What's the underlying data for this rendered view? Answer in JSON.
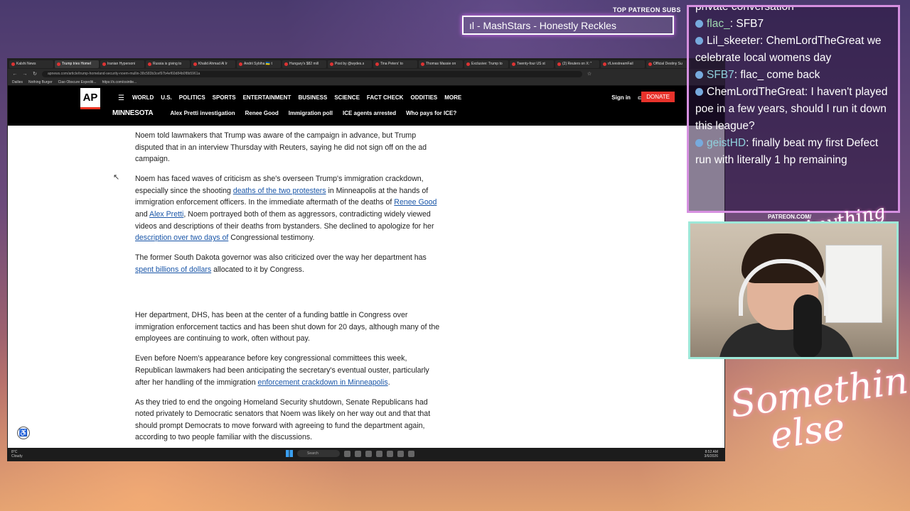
{
  "overlay": {
    "patreon_label": "TOP PATREON SUBS",
    "marquee_text": "ıl - MashStars - Honestly Reckles",
    "patreon_com": "PATREON.COM/",
    "signature_small": "Anything else",
    "signature_large": "Something else"
  },
  "chat": [
    {
      "user": "",
      "text": "private conversation",
      "user_color": "white"
    },
    {
      "user": "flac_",
      "text": ": SFB7",
      "user_color": "green"
    },
    {
      "user": "Lil_skeeter",
      "text": ": ChemLordTheGreat we celebrate local womens day",
      "user_color": "white"
    },
    {
      "user": "SFB7",
      "text": ": flac_  come back",
      "user_color": "teal"
    },
    {
      "user": "ChemLordTheGreat",
      "text": ": I haven't played poe in a few years, should I run it down this league?",
      "user_color": "white"
    },
    {
      "user": "geistHD",
      "text": ": finally beat my first Defect run with literally 1 hp remaining",
      "user_color": "teal"
    }
  ],
  "browser": {
    "tabs": [
      "Kalshi News",
      "Trump tries Homel",
      "Iranian Hypersoni",
      "Russia is giving to",
      "Khalid Ahmad Al Ir",
      "Andrii Sybiha 🇺🇦 t",
      "Hungary's $82 mill",
      "Post by @wydes.s",
      "Tina Peters' to",
      "Thomas Massie on",
      "Exclusive: Trump to",
      "Twenty-four US st",
      "(2) Reuters on X: \"",
      "r/LivestreamFail",
      "Official Destiny Su"
    ],
    "url": "apnews.com/article/trump-homeland-security-noem-mullin-38c583b3cef97b4ef60d84b0f8b5961a",
    "bookmarks": [
      "Dailies",
      "Nothing Burger",
      "Ciao Obscure Expediti...",
      "https://x.com/osintte..."
    ]
  },
  "ap": {
    "logo": "AP",
    "nav": [
      "WORLD",
      "U.S.",
      "POLITICS",
      "SPORTS",
      "ENTERTAINMENT",
      "BUSINESS",
      "SCIENCE",
      "FACT CHECK",
      "ODDITIES",
      "MORE"
    ],
    "sign_in": "Sign in",
    "donate": "DONATE",
    "state": "MINNESOTA",
    "subnav": [
      "Alex Pretti investigation",
      "Renee Good",
      "Immigration poll",
      "ICE agents arrested",
      "Who pays for ICE?"
    ]
  },
  "article": {
    "p1": "Noem told lawmakers that Trump was aware of the campaign in advance, but Trump disputed that in an interview Thursday with Reuters, saying he did not sign off on the ad campaign.",
    "p2_a": "Noem has faced waves of criticism as she's overseen Trump's immigration crackdown, especially since the shooting ",
    "p2_link1": "deaths of the two protesters",
    "p2_b": " in Minneapolis at the hands of immigration enforcement officers. In the immediate aftermath of the deaths of ",
    "p2_link2": "Renee Good",
    "p2_c": " and ",
    "p2_link3": "Alex Pretti",
    "p2_d": ", Noem portrayed both of them as aggressors, contradicting widely viewed videos and descriptions of their deaths from bystanders. She declined to apologize for her ",
    "p2_link4": "description over two days of",
    "p2_e": " Congressional testimony.",
    "p3_a": "The former South Dakota governor was also criticized over the way her department has ",
    "p3_link": "spent billions of dollars",
    "p3_b": " allocated to it by Congress.",
    "p4": "Her department, DHS, has been at the center of a funding battle in Congress over immigration enforcement tactics and has been shut down for 20 days, although many of the employees are continuing to work, often without pay.",
    "p5_a": "Even before Noem's appearance before key congressional committees this week, Republican lawmakers had been anticipating the secretary's eventual ouster, particularly after her handling of the immigration ",
    "p5_link": "enforcement crackdown in Minneapolis",
    "p5_b": ".",
    "p6": "As they tried to end the ongoing Homeland Security shutdown, Senate Republicans had noted privately to Democratic senators that Noem was likely on her way out and that that should prompt Democrats to move forward with agreeing to fund the department again, according to two people familiar with the discussions."
  },
  "taskbar": {
    "weather_temp": "8°C",
    "weather_desc": "Cloudy",
    "search": "Search",
    "time": "8:52 AM",
    "date": "3/6/2026"
  }
}
